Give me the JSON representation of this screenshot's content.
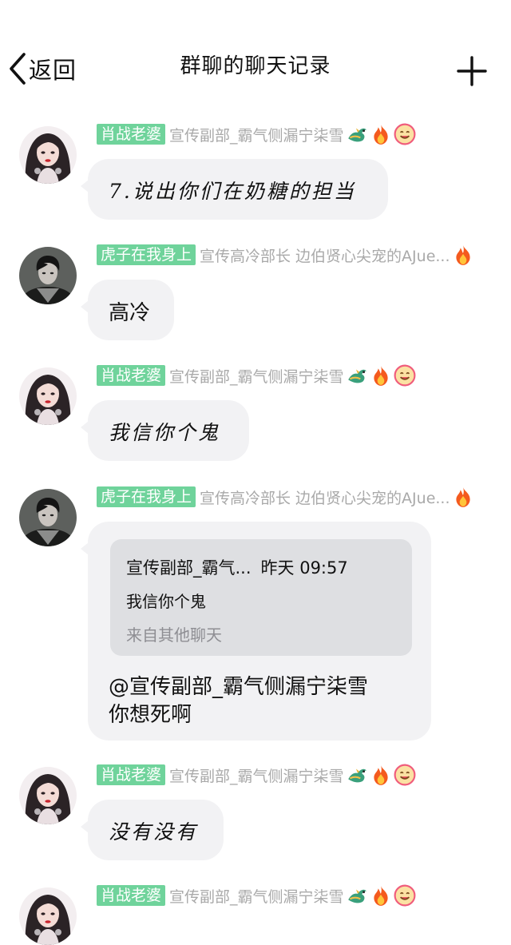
{
  "header": {
    "back_label": "返回",
    "title": "群聊的聊天记录",
    "back_icon": "chevron-left-icon",
    "add_icon": "plus-icon"
  },
  "messages": [
    {
      "tag": "肖战老婆",
      "sender": "宣传副部_霸气侧漏宁柒雪",
      "badges": [
        "dragon-icon",
        "fire-icon",
        "smile-icon"
      ],
      "text": "7.说出你们在奶糖的担当"
    },
    {
      "tag": "虎子在我身上",
      "sender": "宣传高冷部长  边伯贤心尖宠的AJue...",
      "badges": [
        "fire-icon"
      ],
      "text": "高冷"
    },
    {
      "tag": "肖战老婆",
      "sender": "宣传副部_霸气侧漏宁柒雪",
      "badges": [
        "dragon-icon",
        "fire-icon",
        "smile-icon"
      ],
      "text": "我信你个鬼"
    },
    {
      "tag": "虎子在我身上",
      "sender": "宣传高冷部长  边伯贤心尖宠的AJue...",
      "badges": [
        "fire-icon"
      ],
      "quote": {
        "sender": "宣传副部_霸气...",
        "time": "昨天 09:57",
        "text": "我信你个鬼",
        "source": "来自其他聊天"
      },
      "reply_line1": "@宣传副部_霸气侧漏宁柒雪",
      "reply_line2": "你想死啊"
    },
    {
      "tag": "肖战老婆",
      "sender": "宣传副部_霸气侧漏宁柒雪",
      "badges": [
        "dragon-icon",
        "fire-icon",
        "smile-icon"
      ],
      "text": "没有没有"
    },
    {
      "tag": "肖战老婆",
      "sender": "宣传副部_霸气侧漏宁柒雪",
      "badges": [
        "dragon-icon",
        "fire-icon",
        "smile-icon"
      ]
    }
  ],
  "colors": {
    "tag_bg": "#6fd39b",
    "bubble_bg": "#f2f2f4",
    "quote_bg": "#dedfe2",
    "sender_gray": "#a9a9a9"
  }
}
